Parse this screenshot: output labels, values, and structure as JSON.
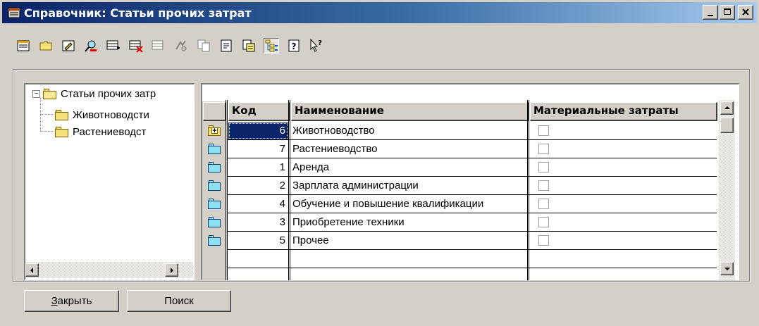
{
  "window": {
    "title": "Справочник: Статьи прочих затрат",
    "caption_buttons": {
      "minimize": "_",
      "maximize": "□",
      "close": "×"
    }
  },
  "toolbar": {
    "icons": [
      "new-item-icon",
      "new-group-icon",
      "edit-icon",
      "find-icon",
      "add-row-icon",
      "delete-row-icon",
      "copy-row-icon",
      "move-icon",
      "copy-icon",
      "properties-icon",
      "print-icon",
      "tree-view-icon",
      "help-icon",
      "context-help-icon"
    ]
  },
  "tree": {
    "root": "Статьи прочих затр",
    "children": [
      "Животноводсти",
      "Растениеводст"
    ]
  },
  "grid": {
    "columns": {
      "code": "Код",
      "name": "Наименование",
      "material": "Материальные затраты"
    },
    "rows": [
      {
        "icon": "group",
        "code": "6",
        "name": "Животноводство",
        "material": false
      },
      {
        "icon": "item",
        "code": "7",
        "name": "Растениеводство",
        "material": false
      },
      {
        "icon": "item",
        "code": "1",
        "name": "Аренда",
        "material": false
      },
      {
        "icon": "item",
        "code": "2",
        "name": "Зарплата администрации",
        "material": false
      },
      {
        "icon": "item",
        "code": "4",
        "name": "Обучение и повышение квалификации",
        "material": false
      },
      {
        "icon": "item",
        "code": "3",
        "name": "Приобретение техники",
        "material": false
      },
      {
        "icon": "item",
        "code": "5",
        "name": "Прочее",
        "material": false
      }
    ],
    "selected_code": "6"
  },
  "buttons": {
    "close_accel": "З",
    "close_rest": "акрыть",
    "search": "Поиск"
  }
}
